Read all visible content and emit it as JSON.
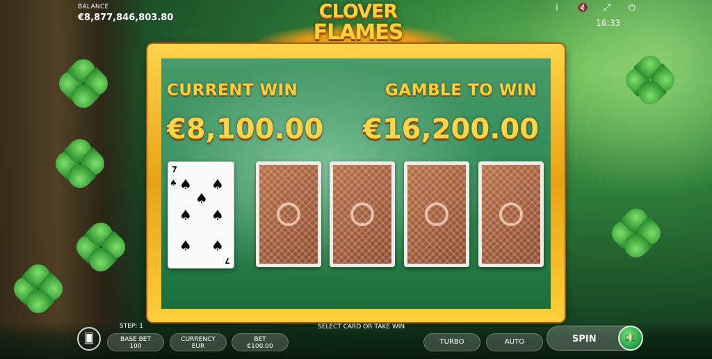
{
  "header": {
    "balance_label": "BALANCE",
    "balance_value": "€8,877,846,803.80",
    "time": "16:33",
    "icons": [
      "info-icon",
      "mute-icon",
      "fullscreen-icon",
      "power-icon"
    ]
  },
  "logo": {
    "line1": "CLOVER",
    "line2": "FLAMES"
  },
  "gamble": {
    "current_win_label": "CURRENT WIN",
    "current_win_value": "€8,100.00",
    "gamble_label": "GAMBLE TO WIN",
    "gamble_value": "€16,200.00"
  },
  "cards": {
    "revealed": {
      "rank": "7",
      "suit": "♠"
    },
    "hidden_count": 4
  },
  "bottom_bar": {
    "step": "STEP: 1",
    "status": "SELECT CARD OR TAKE WIN",
    "base_bet_label": "BASE BET",
    "base_bet_value": "100",
    "currency_label": "CURRENCY",
    "currency_value": "EUR",
    "bet_label": "BET",
    "bet_value": "€100.00",
    "turbo": "TURBO",
    "auto": "AUTO",
    "spin": "SPIN"
  },
  "colors": {
    "gold": "#ffd23c",
    "panel_green": "#2f8a57",
    "card_back": "#a45e3c"
  }
}
